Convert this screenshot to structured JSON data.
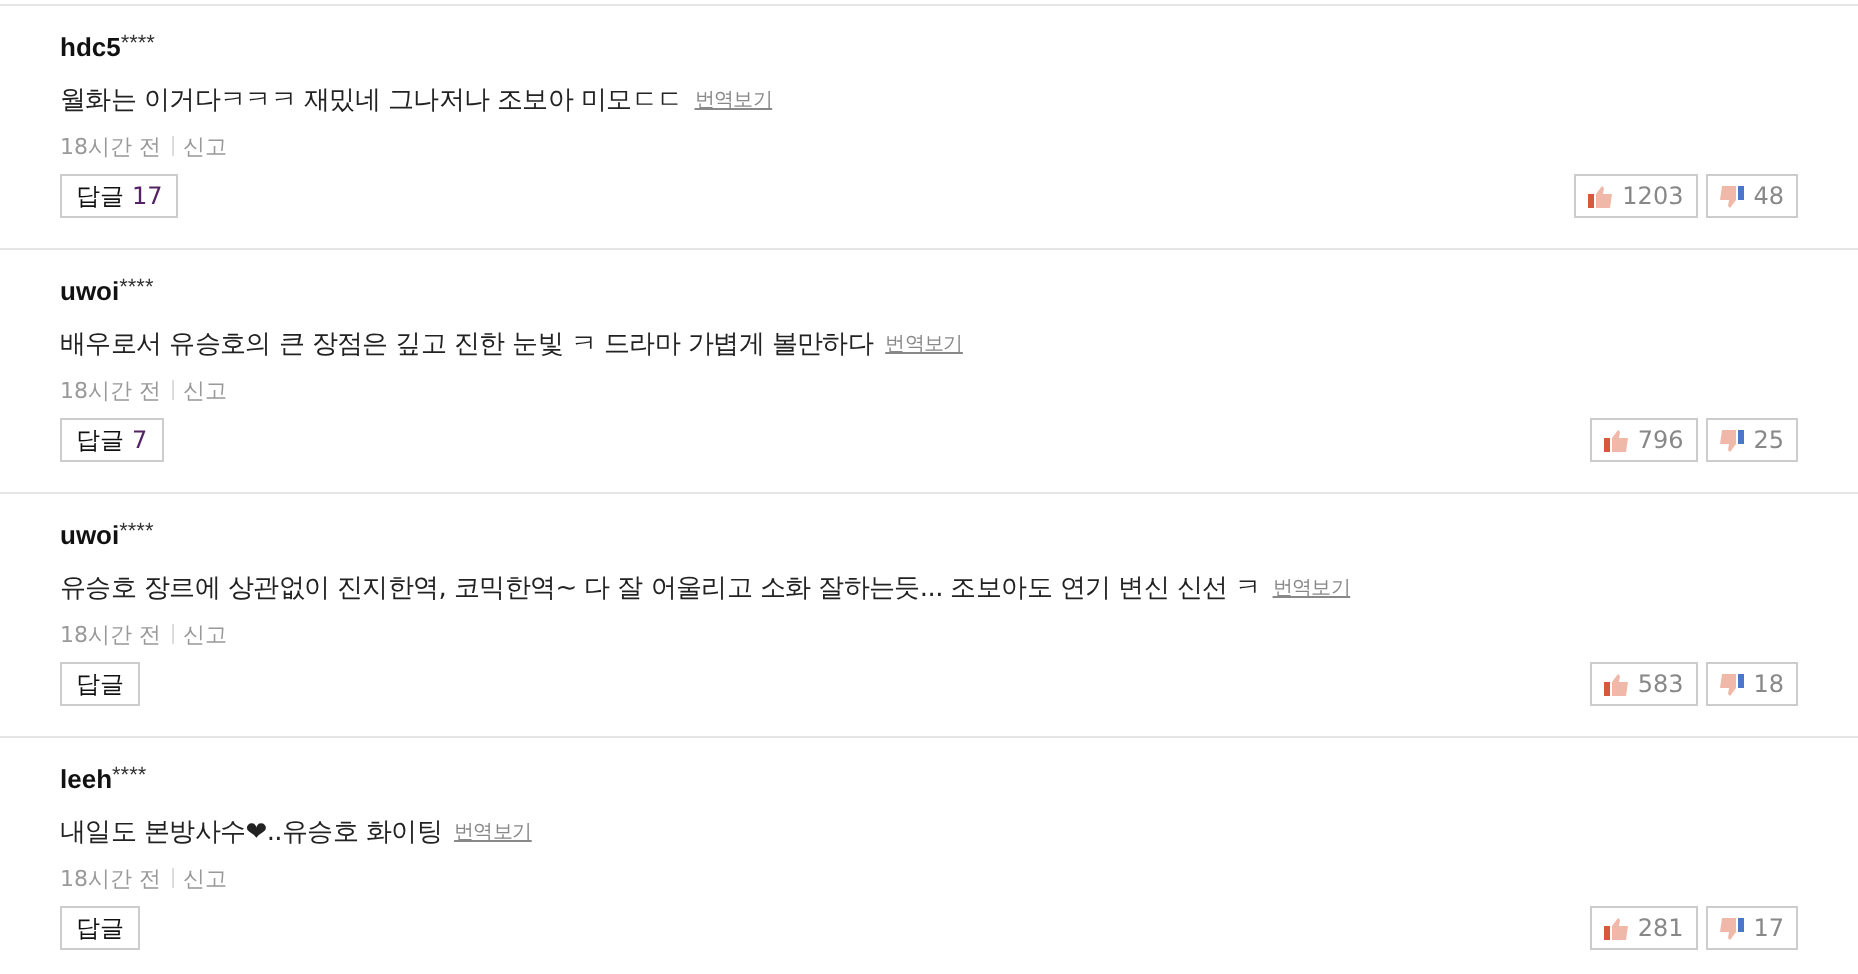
{
  "comments": [
    {
      "user": "hdc5",
      "mask": "****",
      "text": "월화는 이거다ㅋㅋㅋ 재밌네 그나저나 조보아 미모ㄷㄷ",
      "translate": "번역보기",
      "time": "18시간 전",
      "report": "신고",
      "reply_label": "답글",
      "reply_count": "17",
      "likes": "1203",
      "dislikes": "48"
    },
    {
      "user": "uwoi",
      "mask": "****",
      "text": "배우로서 유승호의 큰 장점은 깊고 진한 눈빛 ㅋ 드라마 가볍게 볼만하다",
      "translate": "번역보기",
      "time": "18시간 전",
      "report": "신고",
      "reply_label": "답글",
      "reply_count": "7",
      "likes": "796",
      "dislikes": "25"
    },
    {
      "user": "uwoi",
      "mask": "****",
      "text": "유승호 장르에 상관없이 진지한역, 코믹한역~ 다 잘 어울리고 소화 잘하는듯... 조보아도 연기 변신 신선 ㅋ",
      "translate": "번역보기",
      "time": "18시간 전",
      "report": "신고",
      "reply_label": "답글",
      "likes": "583",
      "dislikes": "18"
    },
    {
      "user": "leeh",
      "mask": "****",
      "text": "내일도 본방사수❤..유승호 화이팅",
      "translate": "번역보기",
      "time": "18시간 전",
      "report": "신고",
      "reply_label": "답글",
      "likes": "281",
      "dislikes": "17"
    }
  ]
}
